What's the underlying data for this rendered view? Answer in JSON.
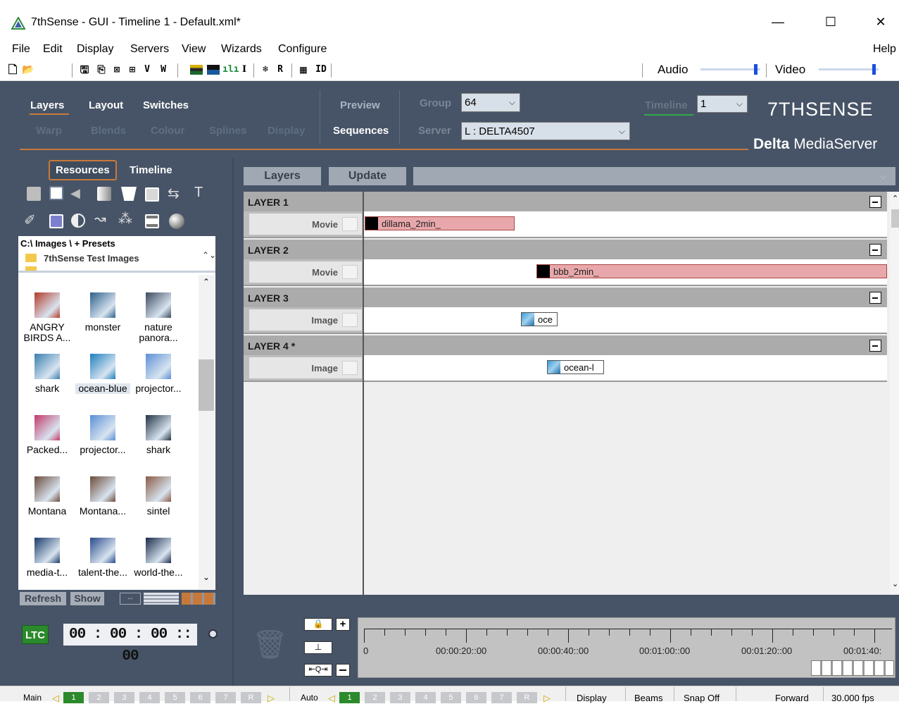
{
  "window": {
    "title": "7thSense -   GUI  - Timeline 1  - Default.xml*",
    "minimize": "—",
    "maximize": "☐",
    "close": "✕"
  },
  "menu": {
    "items": [
      "File",
      "Edit",
      "Display",
      "Servers",
      "View",
      "Wizards",
      "Configure"
    ],
    "help": "Help"
  },
  "toolbar": {
    "letters": [
      "V",
      "W",
      "I",
      "R",
      "ID"
    ],
    "audio_label": "Audio",
    "video_label": "Video",
    "audio_level": 0.95,
    "video_level": 0.95
  },
  "nav": {
    "row1": [
      "Layers",
      "Layout",
      "Switches"
    ],
    "row2": [
      "Warp",
      "Blends",
      "Colour",
      "Splines",
      "Display"
    ],
    "preview": "Preview",
    "sequences": "Sequences",
    "group_label": "Group",
    "group_value": "64",
    "server_label": "Server",
    "server_value": "L : DELTA4507",
    "timeline_label": "Timeline",
    "timeline_value": "1",
    "brand": "7THSENSE",
    "product_bold": "Delta",
    "product_rest": " MediaServer"
  },
  "left": {
    "tabs": [
      "Resources",
      "Timeline"
    ],
    "path": "C:\\ Images \\  + Presets",
    "folder": "7thSense Test Images",
    "thumbs": [
      {
        "label": "ANGRY BIRDS A...",
        "color": "#b43a2a"
      },
      {
        "label": "monster",
        "color": "#2d5f8a"
      },
      {
        "label": "nature panora...",
        "color": "#3d4a5e"
      },
      {
        "label": "shark",
        "color": "#3a7fb0"
      },
      {
        "label": "ocean-blue",
        "color": "#1e7fbf"
      },
      {
        "label": "projector...",
        "color": "#5b8fd6"
      },
      {
        "label": "Packed...",
        "color": "#c23a6a"
      },
      {
        "label": "projector...",
        "color": "#5b8fd6"
      },
      {
        "label": "shark",
        "color": "#223344"
      },
      {
        "label": "Montana",
        "color": "#6b4b3a"
      },
      {
        "label": "Montana...",
        "color": "#6b4b3a"
      },
      {
        "label": "sintel",
        "color": "#8a5a44"
      },
      {
        "label": "media-t...",
        "color": "#1a3a6a"
      },
      {
        "label": "talent-the...",
        "color": "#2a4a8a"
      },
      {
        "label": "world-the...",
        "color": "#1a2a4a"
      }
    ],
    "refresh": "Refresh",
    "show": "Show",
    "ltc": "LTC",
    "timecode": "00 : 00 : 00 :: 00"
  },
  "timeline": {
    "layers_btn": "Layers",
    "update_btn": "Update",
    "layers": [
      {
        "name": "LAYER 1",
        "type": "Movie",
        "clip": "dillama_2min_"
      },
      {
        "name": "LAYER 2",
        "type": "Movie",
        "clip": "bbb_2min_"
      },
      {
        "name": "LAYER 3",
        "type": "Image",
        "clip": "oce"
      },
      {
        "name": "LAYER 4 *",
        "type": "Image",
        "clip": "ocean-l"
      }
    ],
    "ruler": [
      "0",
      "00:00:20::00",
      "00:00:40::00",
      "00:01:00::00",
      "00:01:20::00",
      "00:01:40:"
    ]
  },
  "status": {
    "main": "Main",
    "auto": "Auto",
    "nums": [
      "1",
      "2",
      "3",
      "4",
      "5",
      "6",
      "7",
      "R"
    ],
    "display": "Display",
    "beams": "Beams",
    "snap": "Snap Off",
    "forward": "Forward",
    "fps": "30.000 fps"
  }
}
